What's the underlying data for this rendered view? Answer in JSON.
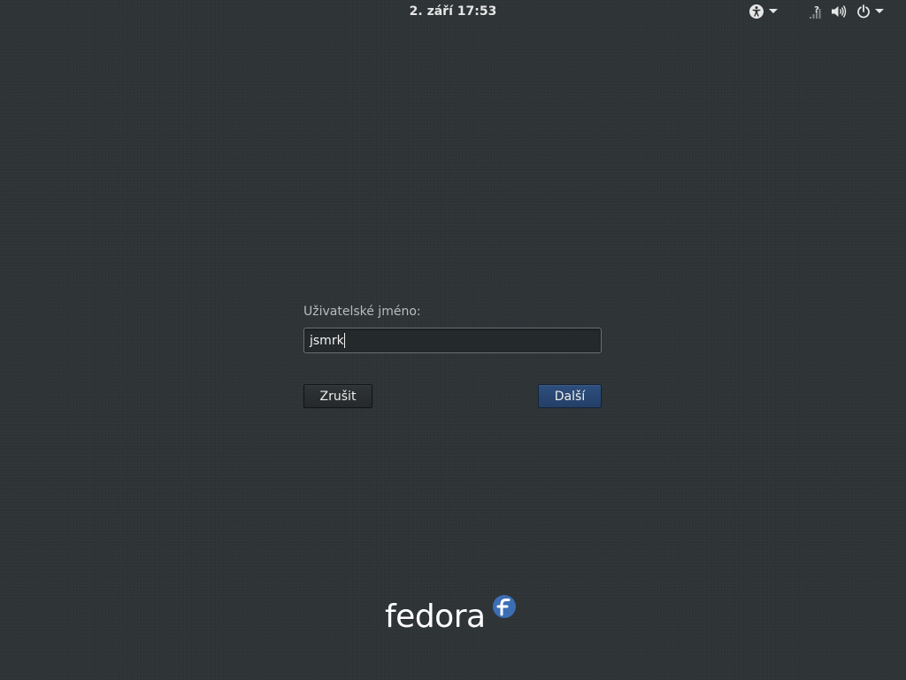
{
  "topbar": {
    "clock": "2. září  17:53",
    "icons": {
      "accessibility": "accessibility-icon",
      "accessibility_menu": "chevron-down-icon",
      "network": "network-unknown-icon",
      "volume": "volume-icon",
      "power": "power-icon",
      "system_menu": "chevron-down-icon"
    }
  },
  "login": {
    "prompt_label": "Uživatelské jméno:",
    "username_value": "jsmrk",
    "cancel_label": "Zrušit",
    "next_label": "Další"
  },
  "branding": {
    "logo_text": "fedora",
    "logo_icon": "fedora-infinity-icon"
  },
  "colors": {
    "background": "#2e3336",
    "accent": "#294b79",
    "fedora_blue": "#3c6eb4"
  }
}
